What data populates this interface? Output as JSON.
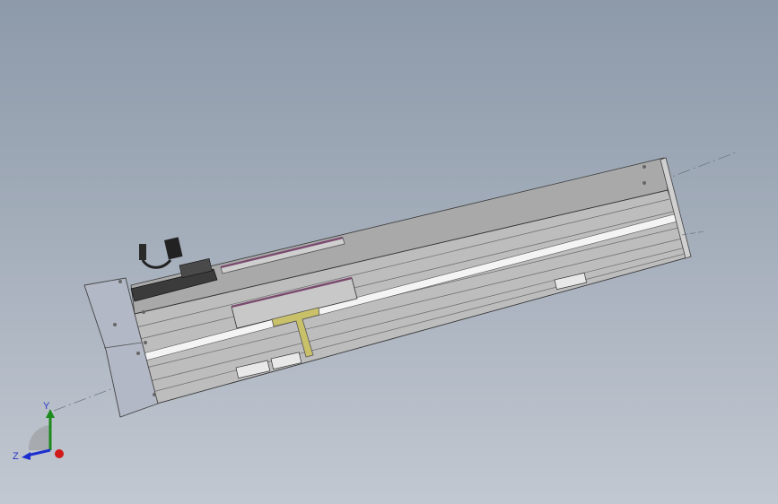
{
  "view": {
    "background_top": "#8d9aaa",
    "background_bottom": "#c2c8d1"
  },
  "model": {
    "body_color": "#bdbdbd",
    "rail_color": "#f2f2f2",
    "bracket_color": "#c9c06a",
    "end_cap_color": "#b4b8c6",
    "stripe_color": "#7a4a6e"
  },
  "triad": {
    "y_label": "Y",
    "z_label": "Z",
    "x_color": "#d01a1a",
    "y_color": "#1c8a1c",
    "z_color": "#1c2ecf"
  }
}
